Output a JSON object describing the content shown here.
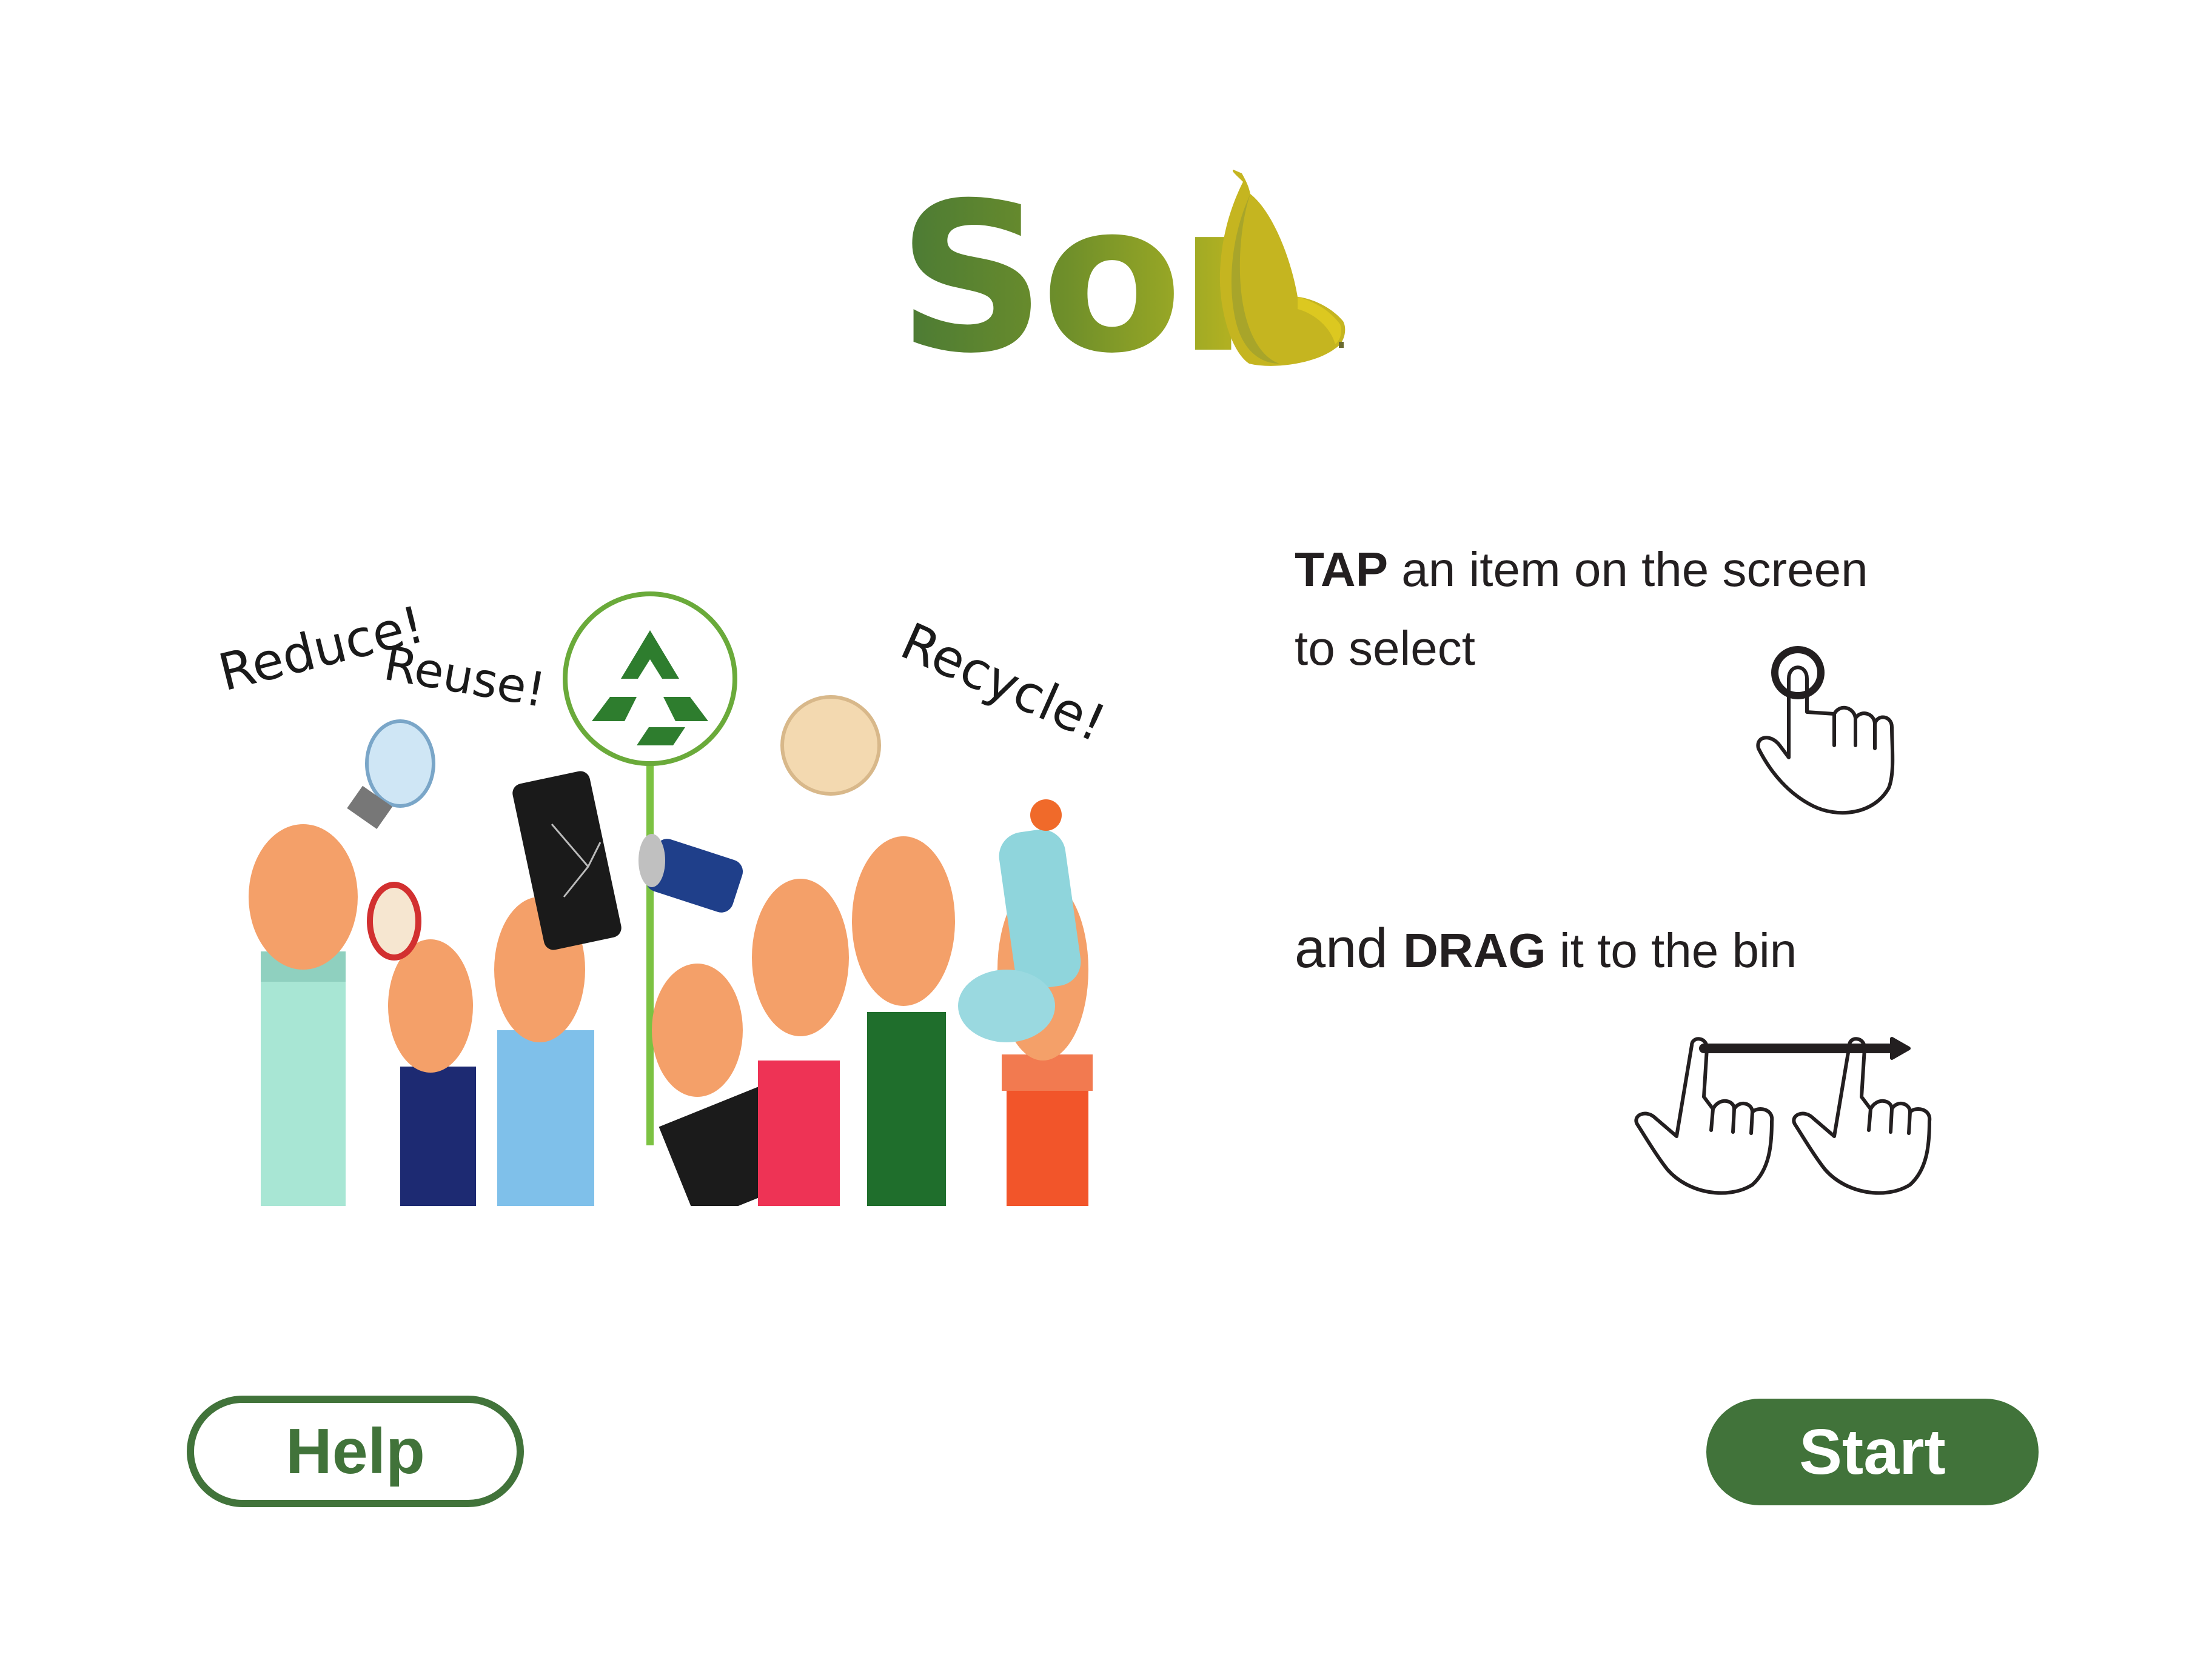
{
  "logo": {
    "text": "Sor"
  },
  "illustration": {
    "labels": [
      "Reduce!",
      "Reuse!",
      "Recycle!"
    ],
    "icon": "recycle-icon"
  },
  "instructions": {
    "tap_keyword": "TAP",
    "tap_rest": " an item on the screen",
    "tap_line2": "to select",
    "drag_and": "and ",
    "drag_keyword": "DRAG",
    "drag_rest": " it to the bin",
    "tap_icon": "tap-gesture-icon",
    "drag_icon": "drag-gesture-icon"
  },
  "buttons": {
    "help_label": "Help",
    "start_label": "Start"
  },
  "colors": {
    "primary": "#41733a",
    "logo_green": "#4a7a35",
    "logo_yellow": "#c7b81f",
    "text": "#231f20",
    "background": "#ffffff"
  }
}
